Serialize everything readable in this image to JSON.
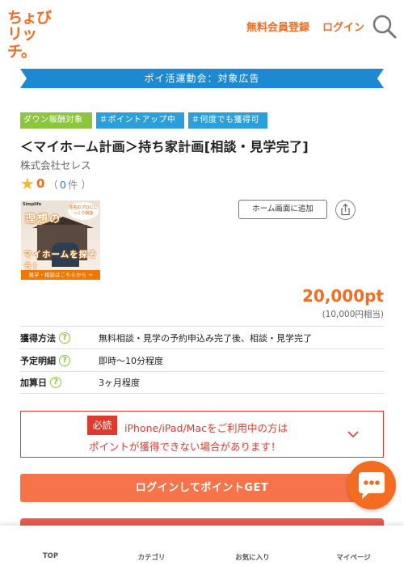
{
  "header": {
    "logo_line1": "ちょび",
    "logo_line2": "リッチ。",
    "register_label": "無料会員登録",
    "login_label": "ログイン",
    "search_icon": "search-icon"
  },
  "banner": {
    "text": "ポイ活運動会：対象広告"
  },
  "tags": [
    {
      "label": "ダウン報酬対象"
    },
    {
      "label": "＃ポイントアップ中"
    },
    {
      "label": "＃何度でも獲得可"
    }
  ],
  "ad": {
    "title": "＜マイホーム計画＞持ち家計画[相談・見学完了]",
    "company": "株式会社セレス",
    "rating_score": "0",
    "rating_open": "（",
    "rating_count": "0",
    "rating_unit": "件 ）",
    "thumb_brand": "Simplife",
    "thumb_bubble": "住宅のプロにじっくり相談",
    "thumb_ideal": "理想の",
    "thumb_myhome": "マイホームを探そう！",
    "thumb_cta": "見学・相談はこちらから →",
    "add_home_label": "ホーム画面に追加",
    "points": "20,000pt",
    "points_yen": "(10,000円相当)"
  },
  "info": [
    {
      "label": "獲得方法",
      "value": "無料相談・見学の予約申込み完了後、相談・見学完了"
    },
    {
      "label": "予定明細",
      "value": "即時～10分程度"
    },
    {
      "label": "加算日",
      "value": "3ヶ月程度"
    }
  ],
  "notice": {
    "badge": "必読",
    "line1": "iPhone/iPad/Macをご利用中の方は",
    "line2": "ポイントが獲得できない場合があります！"
  },
  "actions": {
    "login_get": "ログインしてポイントGET"
  },
  "tabbar": [
    {
      "label": "TOP"
    },
    {
      "label": "カテゴリ"
    },
    {
      "label": "お気に入り"
    },
    {
      "label": "マイページ"
    }
  ],
  "colors": {
    "accent": "#f26d21",
    "blue": "#1e88d0",
    "green": "#8cc63f",
    "alert": "#e03a2e"
  }
}
